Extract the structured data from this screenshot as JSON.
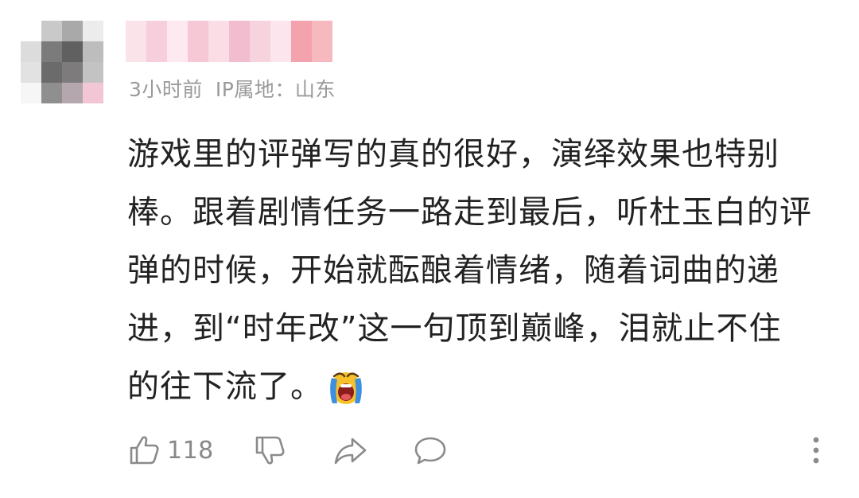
{
  "post": {
    "time_ago": "3小时前",
    "ip_location": "IP属地：山东",
    "content_lines": [
      "游戏里的评弹写的真的很好，演绎效果也特别",
      "棒。跟着剧情任务一路走到最后，听杜玉白的评",
      "弹的时候，开始就酝酿着情绪，随着词曲的递",
      "进，到“时年改”这一句顶到巅峰，泪就止不住",
      "的往下流了。"
    ],
    "emoji": "loud-crying-emoji"
  },
  "actions": {
    "like_icon": "thumbs-up-icon",
    "like_count": "118",
    "dislike_icon": "thumbs-down-icon",
    "share_icon": "share-arrow-icon",
    "comment_icon": "comment-bubble-icon",
    "more_icon": "more-vertical-icon"
  },
  "colors": {
    "meta_text": "#9a9a9a",
    "body_text": "#222222",
    "icon": "#8a8a8a"
  }
}
